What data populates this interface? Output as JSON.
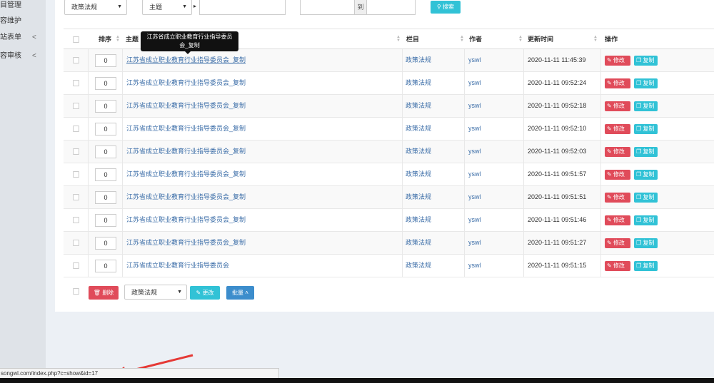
{
  "sidebar": {
    "items": [
      {
        "label": "目管理",
        "chev": ""
      },
      {
        "label": "容维护",
        "chev": ""
      },
      {
        "label": "站表单",
        "chev": "<"
      },
      {
        "label": "容审核",
        "chev": "<"
      }
    ]
  },
  "filters": {
    "category_select": "政策法规",
    "field_select": "主题",
    "field_arrow": "▸",
    "range_sep": "到",
    "search_button": "搜索"
  },
  "table": {
    "headers": {
      "sort": "排序",
      "title": "主题",
      "column": "栏目",
      "author": "作者",
      "updated": "更新时间",
      "actions": "操作"
    },
    "rows": [
      {
        "sort": "0",
        "title": "江苏省成立职业教育行业指导委员会_复制",
        "column": "政策法规",
        "author": "yswl",
        "updated": "2020-11-11 11:45:39"
      },
      {
        "sort": "0",
        "title": "江苏省成立职业教育行业指导委员会_复制",
        "column": "政策法规",
        "author": "yswl",
        "updated": "2020-11-11 09:52:24"
      },
      {
        "sort": "0",
        "title": "江苏省成立职业教育行业指导委员会_复制",
        "column": "政策法规",
        "author": "yswl",
        "updated": "2020-11-11 09:52:18"
      },
      {
        "sort": "0",
        "title": "江苏省成立职业教育行业指导委员会_复制",
        "column": "政策法规",
        "author": "yswl",
        "updated": "2020-11-11 09:52:10"
      },
      {
        "sort": "0",
        "title": "江苏省成立职业教育行业指导委员会_复制",
        "column": "政策法规",
        "author": "yswl",
        "updated": "2020-11-11 09:52:03"
      },
      {
        "sort": "0",
        "title": "江苏省成立职业教育行业指导委员会_复制",
        "column": "政策法规",
        "author": "yswl",
        "updated": "2020-11-11 09:51:57"
      },
      {
        "sort": "0",
        "title": "江苏省成立职业教育行业指导委员会_复制",
        "column": "政策法规",
        "author": "yswl",
        "updated": "2020-11-11 09:51:51"
      },
      {
        "sort": "0",
        "title": "江苏省成立职业教育行业指导委员会_复制",
        "column": "政策法规",
        "author": "yswl",
        "updated": "2020-11-11 09:51:46"
      },
      {
        "sort": "0",
        "title": "江苏省成立职业教育行业指导委员会_复制",
        "column": "政策法规",
        "author": "yswl",
        "updated": "2020-11-11 09:51:27"
      },
      {
        "sort": "0",
        "title": "江苏省成立职业教育行业指导委员会",
        "column": "政策法规",
        "author": "yswl",
        "updated": "2020-11-11 09:51:15"
      }
    ],
    "edit_label": "修改",
    "copy_label": "复制"
  },
  "tooltip": {
    "line1": "江苏省成立职业教育行业指导委员",
    "line2": "会_复制"
  },
  "bulk": {
    "delete_label": "删除",
    "category_select": "政策法规",
    "change_label": "更改",
    "batch_label": "批量"
  },
  "statusbar": {
    "url": "songwl.com/index.php?c=show&id=17"
  },
  "colors": {
    "danger": "#e04b5a",
    "info": "#31c2d6",
    "primary": "#3c8dcc",
    "link": "#3c6ea8",
    "annotation_arrow": "#e53935"
  }
}
